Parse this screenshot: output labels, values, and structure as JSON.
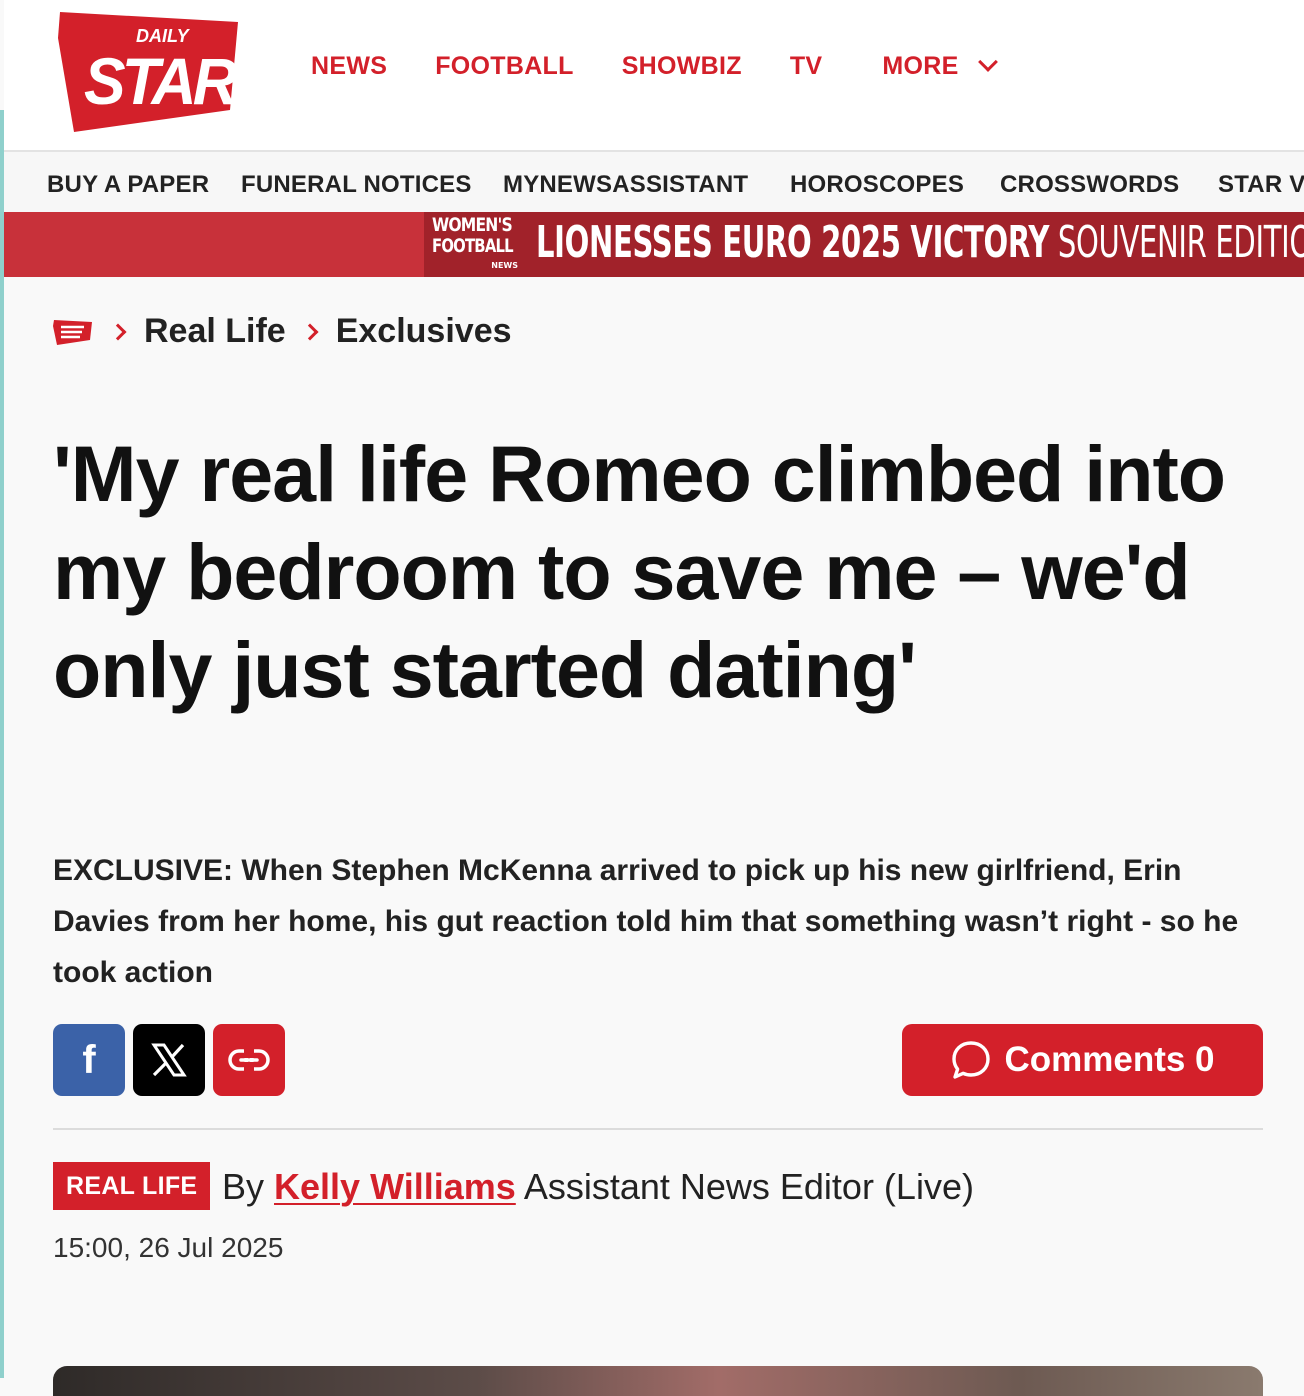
{
  "logo": {
    "daily": "DAILY",
    "star": "STAR"
  },
  "main_nav": {
    "news": "NEWS",
    "football": "FOOTBALL",
    "showbiz": "SHOWBIZ",
    "tv": "TV",
    "more": "MORE"
  },
  "sub_nav": {
    "items": [
      "BUY A PAPER",
      "FUNERAL NOTICES",
      "MYNEWSASSISTANT",
      "HOROSCOPES",
      "CROSSWORDS",
      "STAR V"
    ]
  },
  "promo": {
    "badge_line1": "WOMEN'S",
    "badge_line2": "FOOTBALL",
    "badge_line3": "NEWS",
    "title_bold": "LIONESSES EURO 2025 VICTORY",
    "title_thin": " SOUVENIR EDITIO"
  },
  "breadcrumb": {
    "items": [
      "Real Life",
      "Exclusives"
    ]
  },
  "article": {
    "headline": "'My real life Romeo climbed into my bedroom to save me – we'd only just started dating'",
    "standfirst": "EXCLUSIVE: When Stephen McKenna arrived to pick up his new girlfriend, Erin Davies from her home, his gut reaction told him that something wasn’t right - so he took action",
    "tag": "REAL LIFE",
    "by": "By ",
    "author": "Kelly Williams",
    "author_role": " Assistant News Editor (Live)",
    "timestamp": "15:00, 26 Jul 2025"
  },
  "share": {
    "facebook_glyph": "f",
    "comments_label": "Comments 0"
  },
  "colors": {
    "brand_red": "#d3202a",
    "facebook_blue": "#3b62a8",
    "promo_red": "#c8313a"
  },
  "icons": [
    "star-logo",
    "chevron-down-icon",
    "chevron-right-icon",
    "facebook-icon",
    "x-icon",
    "link-icon",
    "comment-bubble-icon"
  ]
}
